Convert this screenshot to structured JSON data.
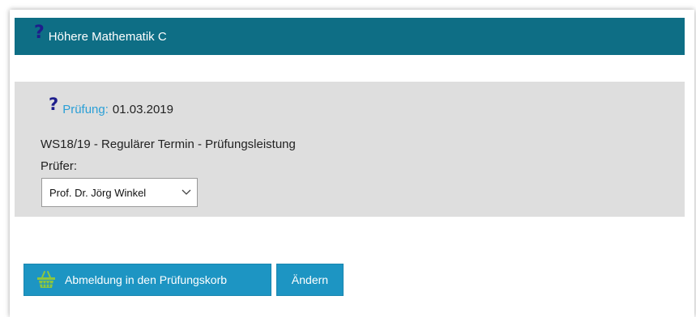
{
  "course": {
    "help_icon": "?",
    "title": "Höhere Mathematik C"
  },
  "exam": {
    "help_icon": "?",
    "label": "Prüfung:",
    "date": "01.03.2019",
    "description": "WS18/19 - Regulärer Termin - Prüfungsleistung",
    "examiner_label": "Prüfer:",
    "examiner_selected": "Prof. Dr. Jörg Winkel"
  },
  "actions": {
    "basket_button_label": "Abmeldung in den Prüfungskorb",
    "basket_icon": "basket-icon",
    "change_button_label": "Ändern"
  },
  "colors": {
    "header_bg": "#0e6e85",
    "help_icon": "#1e1e8c",
    "link": "#2a9fd6",
    "button_bg": "#1d95c3",
    "basket_icon": "#8cc63f",
    "exam_box_bg": "#dedede"
  }
}
